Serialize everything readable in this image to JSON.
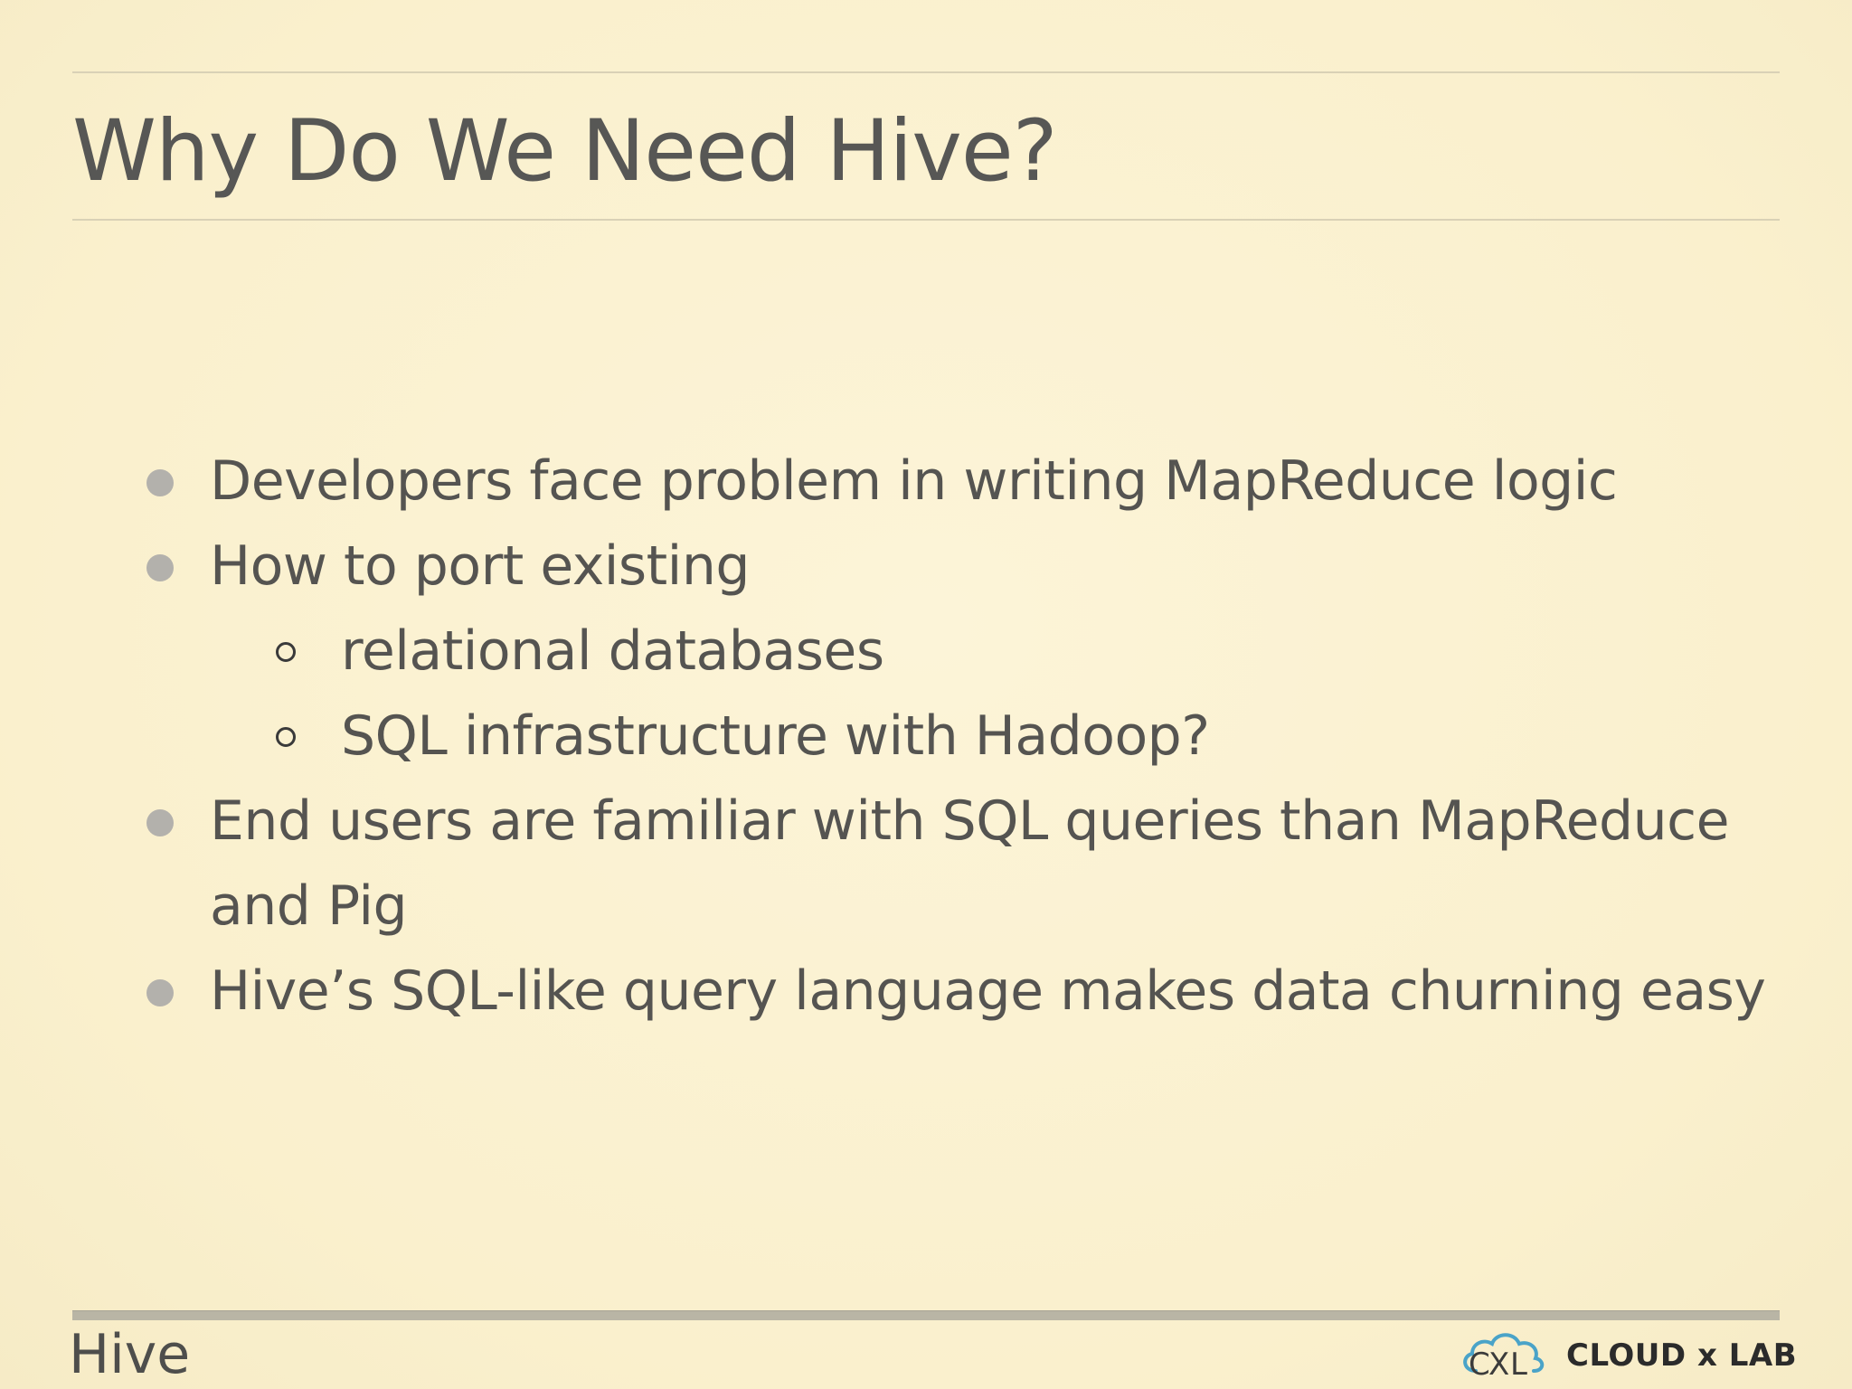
{
  "slide": {
    "title": "Why Do We Need Hive?",
    "bullets": [
      {
        "text": "Developers face problem in writing MapReduce logic"
      },
      {
        "text": "How to port existing"
      },
      {
        "text": "relational databases",
        "level": 2
      },
      {
        "text": "SQL infrastructure with Hadoop?",
        "level": 2
      },
      {
        "text": "End users are familiar with SQL queries than MapReduce"
      },
      {
        "text": "and Pig",
        "continuation": true
      },
      {
        "text": "Hive’s SQL-like query language makes data churning easy"
      }
    ]
  },
  "footer": {
    "section_title": "Hive",
    "logo": {
      "icon": "cloud-xl-icon",
      "text": "CLOUD x LAB",
      "colors": {
        "cloud": "#4aa3c8",
        "text": "#2b2b2b"
      }
    }
  },
  "colors": {
    "background": "#fbf2d2",
    "text": "#555451",
    "bullet": "#b3b1ac",
    "rule": "#d9d1b6",
    "footer_rule": "#b9b5a5"
  }
}
